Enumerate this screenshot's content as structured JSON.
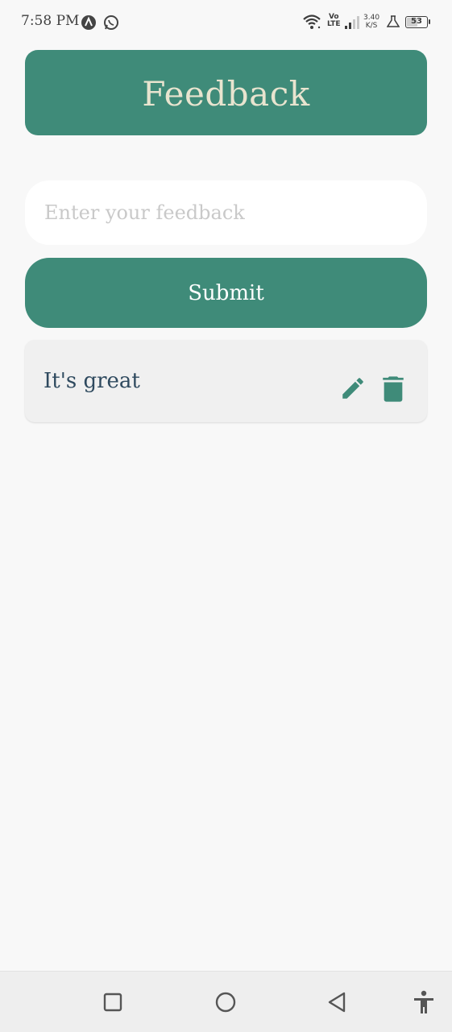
{
  "status_bar": {
    "time": "7:58 PM",
    "volte_top": "Vo",
    "volte_bottom": "LTE",
    "speed_value": "3.40",
    "speed_unit": "K/S",
    "battery": "53"
  },
  "header": {
    "title": "Feedback"
  },
  "form": {
    "input_value": "",
    "input_placeholder": "Enter your feedback",
    "submit_label": "Submit"
  },
  "feedback_list": [
    {
      "text": "It's great",
      "edit_icon": "pencil-icon",
      "delete_icon": "trash-icon"
    }
  ],
  "colors": {
    "primary": "#3f8b79",
    "header_text": "#e8e4cf",
    "item_text": "#2f4a5f",
    "background": "#f8f8f8"
  },
  "nav_bar": {
    "icons": [
      "square-icon",
      "circle-icon",
      "back-triangle-icon",
      "accessibility-icon"
    ]
  }
}
